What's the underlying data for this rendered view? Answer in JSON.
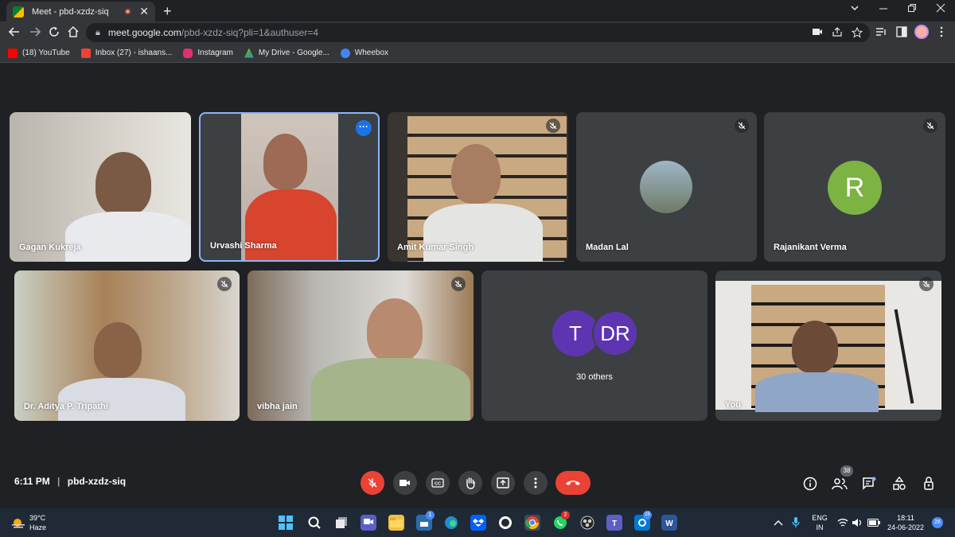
{
  "browser": {
    "tab_title": "Meet - pbd-xzdz-siq",
    "tab_close": "✕",
    "new_tab": "+",
    "url_host": "meet.google.com",
    "url_path": "/pbd-xzdz-siq?pli=1&authuser=4",
    "bookmarks": [
      {
        "label": "(18) YouTube",
        "color": "#ff0000"
      },
      {
        "label": "Inbox (27) - ishaans...",
        "color": "#ea4335"
      },
      {
        "label": "Instagram",
        "color": "#e1306c"
      },
      {
        "label": "My Drive - Google...",
        "color": "#fbbc04"
      },
      {
        "label": "Wheebox",
        "color": "#4285f4"
      }
    ]
  },
  "meeting": {
    "time": "6:11 PM",
    "separator": "|",
    "code": "pbd-xzdz-siq",
    "participants": [
      {
        "name": "Gagan Kukreja"
      },
      {
        "name": "Urvashi Sharma"
      },
      {
        "name": "Amit Kumar Singh"
      },
      {
        "name": "Madan Lal"
      },
      {
        "name": "Rajanikant Verma",
        "initial": "R",
        "color": "#7cb342"
      },
      {
        "name": "Dr. Aditya P. Tripathi"
      },
      {
        "name": "vibha jain"
      },
      {
        "name": "You"
      }
    ],
    "others": {
      "initial_1": "T",
      "initial_2": "DR",
      "label": "30 others",
      "color": "#5e35b1"
    },
    "people_count": "38",
    "accent_red": "#ea4335"
  },
  "taskbar": {
    "weather_temp": "39°C",
    "weather_desc": "Haze",
    "lang_1": "ENG",
    "lang_2": "IN",
    "clock_time": "18:11",
    "clock_date": "24-06-2022",
    "teams_badge": "1",
    "whatsapp_badge": "2",
    "outlook_badge": "25",
    "notif_badge": "26"
  }
}
